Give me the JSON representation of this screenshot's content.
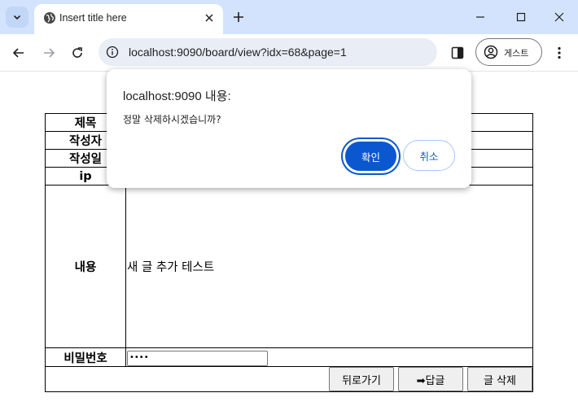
{
  "browser": {
    "tab_title": "Insert title here",
    "url": "localhost:9090/board/view?idx=68&page=1",
    "profile_label": "게스트"
  },
  "colors": {
    "titlebar": "#d3e3fd",
    "omnibox": "#e9eef6",
    "accent": "#0b57d0"
  },
  "board": {
    "rows": [
      {
        "label": "제목",
        "value": ""
      },
      {
        "label": "작성자",
        "value": ""
      },
      {
        "label": "작성일",
        "value": ""
      },
      {
        "label": "ip",
        "value": ""
      }
    ],
    "content_label": "내용",
    "content_value": "새 글 추가 테스트",
    "password_label": "비밀번호",
    "password_value": "••••",
    "buttons": {
      "back": "뒤로가기",
      "reply": "➡답글",
      "delete": "글 삭제"
    }
  },
  "dialog": {
    "title": "localhost:9090 내용:",
    "message": "정말 삭제하시겠습니까?",
    "ok_label": "확인",
    "cancel_label": "취소"
  }
}
